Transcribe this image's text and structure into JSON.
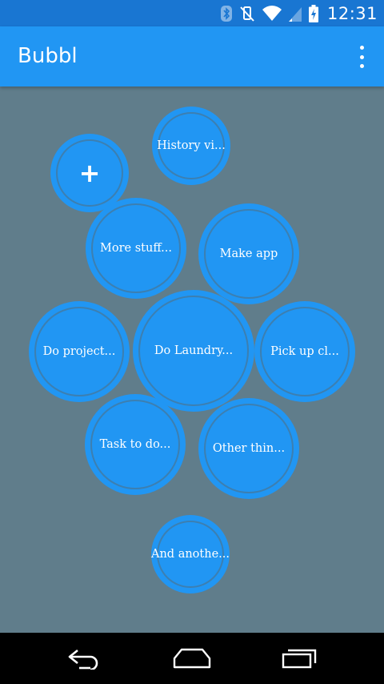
{
  "status_bar": {
    "time": "12:31",
    "icons": [
      "bluetooth-icon",
      "vibrate-off-icon",
      "wifi-icon",
      "signal-icon",
      "battery-charging-icon"
    ]
  },
  "app_bar": {
    "title": "Bubbl",
    "overflow_icon": "more-vert-icon"
  },
  "bubbles": {
    "add": {
      "label": "+"
    },
    "history": {
      "label": "History vi..."
    },
    "more_stuff": {
      "label": "More stuff..."
    },
    "make_app": {
      "label": "Make app"
    },
    "do_project": {
      "label": "Do project..."
    },
    "do_laundry": {
      "label": "Do Laundry..."
    },
    "pick_up": {
      "label": "Pick up cl..."
    },
    "task_to_do": {
      "label": "Task to do..."
    },
    "other_thin": {
      "label": "Other thin..."
    },
    "and_another": {
      "label": "And anothe..."
    }
  },
  "nav_bar": {
    "icons": [
      "back-icon",
      "home-icon",
      "recents-icon"
    ]
  },
  "colors": {
    "status_bar": "#1976D2",
    "app_bar": "#2196F3",
    "canvas": "#607D8B",
    "bubble": "#2196F3"
  }
}
